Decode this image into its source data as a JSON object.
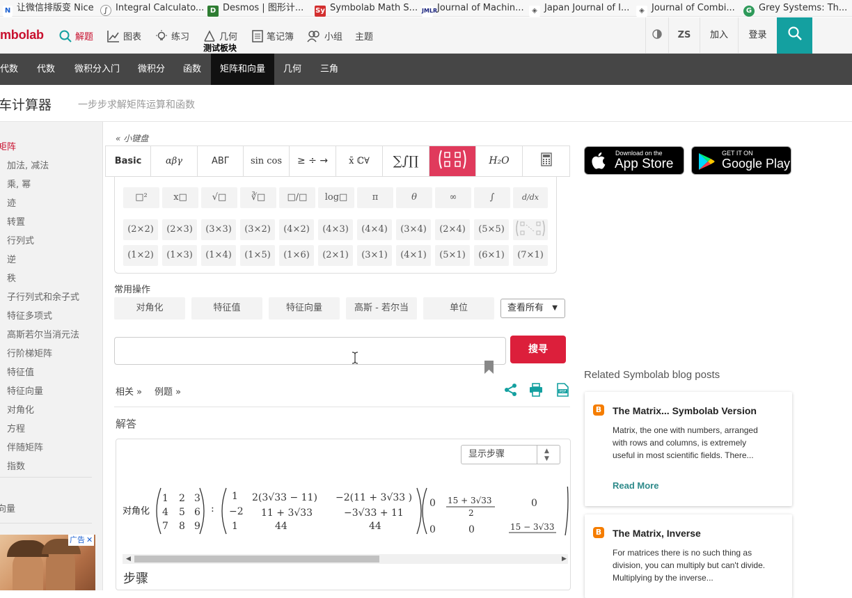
{
  "bookmarks": [
    {
      "label": "让微信排版变 Nice",
      "icon": "nice-icon"
    },
    {
      "label": "Integral Calculato...",
      "icon": "integral-calc-icon"
    },
    {
      "label": "Desmos | 图形计...",
      "icon": "desmos-icon"
    },
    {
      "label": "Symbolab Math S...",
      "icon": "symbolab-icon"
    },
    {
      "label": "Journal of Machin...",
      "icon": "jmlr-icon"
    },
    {
      "label": "Japan Journal of I...",
      "icon": "japan-journal-icon"
    },
    {
      "label": "Journal of Combi...",
      "icon": "combi-journal-icon"
    },
    {
      "label": "Grey Systems: Th...",
      "icon": "grey-systems-icon"
    }
  ],
  "header": {
    "logo": "mbolab",
    "nav": [
      {
        "label": "解题",
        "icon": "search-icon",
        "active": true
      },
      {
        "label": "图表",
        "icon": "chart-icon"
      },
      {
        "label": "练习",
        "icon": "bulb-icon"
      },
      {
        "label": "几何",
        "icon": "geometry-icon"
      },
      {
        "label": "笔记簿",
        "icon": "notebook-icon"
      },
      {
        "label": "小组",
        "icon": "group-icon"
      },
      {
        "label": "主题",
        "icon": ""
      }
    ],
    "tooltip": "测试板块",
    "contrast_icon": "contrast-icon",
    "lang": "ZS",
    "join": "加入",
    "login": "登录",
    "search_icon": "search-icon"
  },
  "subnav": [
    {
      "label": "代数",
      "active": false
    },
    {
      "label": "代数",
      "active": false
    },
    {
      "label": "微积分入门",
      "active": false
    },
    {
      "label": "微积分",
      "active": false
    },
    {
      "label": "函数",
      "active": false
    },
    {
      "label": "矩阵和向量",
      "active": true
    },
    {
      "label": "几何",
      "active": false
    },
    {
      "label": "三角",
      "active": false
    }
  ],
  "page": {
    "title": "车计算器",
    "subtitle": "一步步求解矩阵运算和函数"
  },
  "sidebar": {
    "items": [
      "矩阵",
      "加法, 减法",
      "乘, 幂",
      "迹",
      "转置",
      "行列式",
      "逆",
      "秩",
      "子行列式和余子式",
      "特征多项式",
      "高斯若尔当消元法",
      "行阶梯矩阵",
      "特征值",
      "特征向量",
      "对角化",
      "方程",
      "伴随矩阵",
      "指数"
    ],
    "bottom_item": "向量",
    "ad_label": "广告"
  },
  "keypad": {
    "toggle": "« 小键盘",
    "tabs": [
      "Basic",
      "αβγ",
      "ABΓ",
      "sin cos",
      "≥ ÷ →",
      "x̄ ℂ∀",
      "∑∫∏",
      "matrix",
      "H₂O",
      "calculator"
    ],
    "active_tab": 7,
    "row1": [
      "□²",
      "x□",
      "√□",
      "∛□",
      "□/□",
      "log□",
      "π",
      "θ",
      "∞",
      "∫",
      "d/dx"
    ],
    "row2": [
      "(2×2)",
      "(2×3)",
      "(3×3)",
      "(3×2)",
      "(4×2)",
      "(4×3)",
      "(4×4)",
      "(3×4)",
      "(2×4)",
      "(5×5)"
    ],
    "row3": [
      "(1×2)",
      "(1×3)",
      "(1×4)",
      "(1×5)",
      "(1×6)",
      "(2×1)",
      "(3×1)",
      "(4×1)",
      "(5×1)",
      "(6×1)",
      "(7×1)"
    ]
  },
  "common_ops": {
    "label": "常用操作",
    "items": [
      "对角化",
      "特征值",
      "特征向量",
      "高斯 - 若尔当",
      "单位"
    ],
    "view_all": "查看所有"
  },
  "query": {
    "value": "",
    "submit": "搜寻"
  },
  "links": {
    "related": "相关 »",
    "examples": "例题 »"
  },
  "solution": {
    "label": "解答",
    "show_steps": "显示步骤",
    "prefix": "对角化",
    "steps_label": "步骤"
  },
  "apps": {
    "apple_small": "Download on the",
    "apple_big": "App Store",
    "google_small": "GET IT ON",
    "google_big": "Google Play"
  },
  "blog": {
    "heading": "Related Symbolab blog posts",
    "posts": [
      {
        "title": "The Matrix... Symbolab Version",
        "body": "Matrix, the one with numbers, arranged with rows and columns, is extremely useful in most scientific fields. There...",
        "more": "Read More"
      },
      {
        "title": "The Matrix, Inverse",
        "body": "For matrices there is no such thing as division, you can multiply but can't divide. Multiplying by the inverse...",
        "more": ""
      }
    ]
  },
  "colors": {
    "accent_red": "#e03a5c",
    "teal": "#14a0a0",
    "dark_nav": "#464646"
  }
}
